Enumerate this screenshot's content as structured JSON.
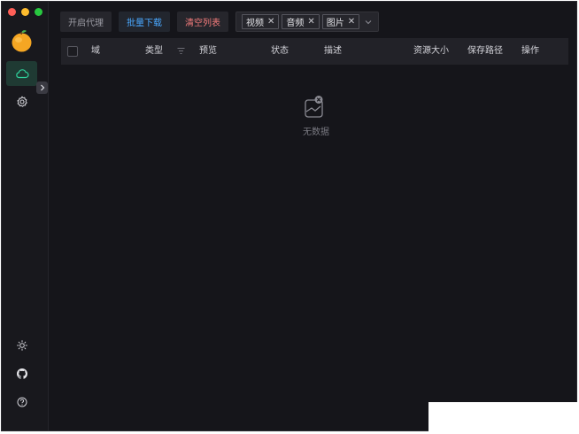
{
  "sidebar": {
    "nav": [
      {
        "name": "cloud-icon",
        "active": true
      },
      {
        "name": "gear-icon",
        "active": false
      }
    ],
    "bottom_icons": [
      "sun-icon",
      "github-icon",
      "help-icon"
    ]
  },
  "toolbar": {
    "proxy_label": "开启代理",
    "batch_download_label": "批量下载",
    "clear_list_label": "清空列表",
    "tags": [
      "视频",
      "音频",
      "图片"
    ]
  },
  "table": {
    "columns": [
      "域",
      "类型",
      "预览",
      "状态",
      "描述",
      "资源大小",
      "保存路径",
      "操作"
    ]
  },
  "empty": {
    "text": "无数据"
  },
  "colors": {
    "accent": "#4aa8ff",
    "danger": "#f47c7c",
    "active_nav": "#1f3a33"
  }
}
